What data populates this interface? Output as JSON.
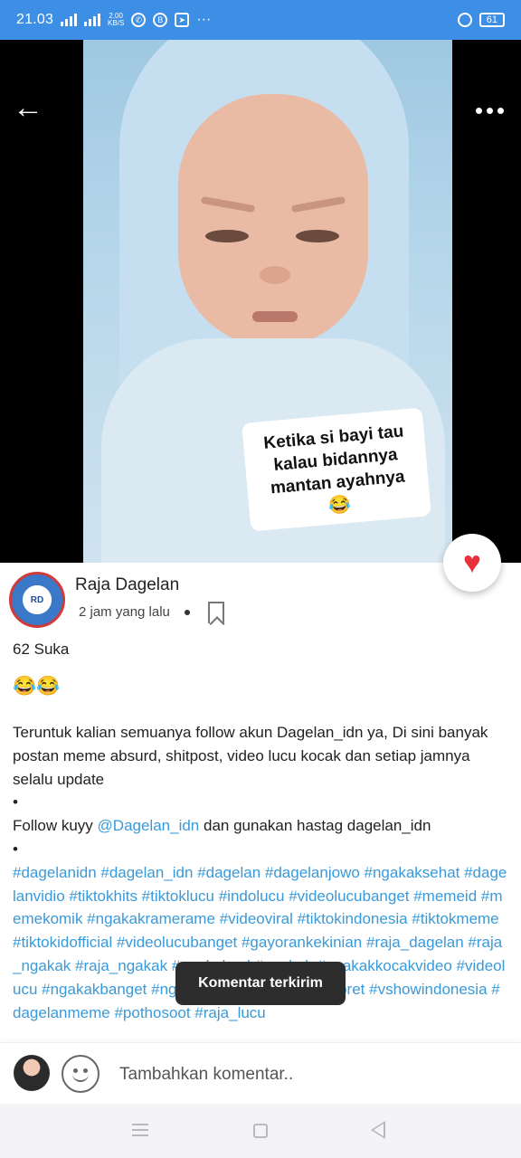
{
  "status_bar": {
    "time": "21.03",
    "net_speed": "2.00\nKB/S",
    "battery": "61"
  },
  "post": {
    "image_caption": "Ketika si bayi tau\nkalau bidannya\nmantan ayahnya",
    "image_caption_emoji": "😂",
    "author": "Raja Dagelan",
    "time_ago": "2 jam yang lalu",
    "likes": "62 Suka",
    "emoji_line": "😂😂",
    "body_line1": "Teruntuk kalian semuanya follow akun Dagelan_idn ya, Di sini banyak postan meme absurd, shitpost, video lucu kocak dan setiap jamnya selalu update",
    "bullet1": "•",
    "follow_prefix": "Follow kuyy ",
    "mention": "@Dagelan_idn",
    "follow_suffix": " dan gunakan hastag dagelan_idn",
    "bullet2": "•",
    "hashtags": "#dagelanidn #dagelan_idn #dagelan #dagelanjowo #ngakaksehat #dagelanvidio #tiktokhits #tiktoklucu #indolucu #videolucubanget #memeid #memekomik #ngakakramerame #videoviral #tiktokindonesia #tiktokmeme #tiktokidofficial #videolucubanget #gayorankekinian #raja_dagelan #raja_ngakak #raja_ngakak #ngakakpol #ngakak #ngakakkocakvideo #videolucu #ngakakbanget #ngakaksehat #ngakakkampret #vshowindonesia #dagelanmeme #pothosoot #raja_lucu"
  },
  "toast": "Komentar terkirim",
  "comment_bar": {
    "placeholder": "Tambahkan komentar.."
  },
  "colors": {
    "status_bar": "#3d8ee5",
    "link": "#3a9ad9",
    "heart": "#e8313b"
  },
  "icons": [
    "back-arrow-icon",
    "more-dots-icon",
    "heart-icon",
    "bookmark-icon",
    "emoji-smile-icon",
    "nav-menu-icon",
    "nav-home-icon",
    "nav-back-icon"
  ]
}
